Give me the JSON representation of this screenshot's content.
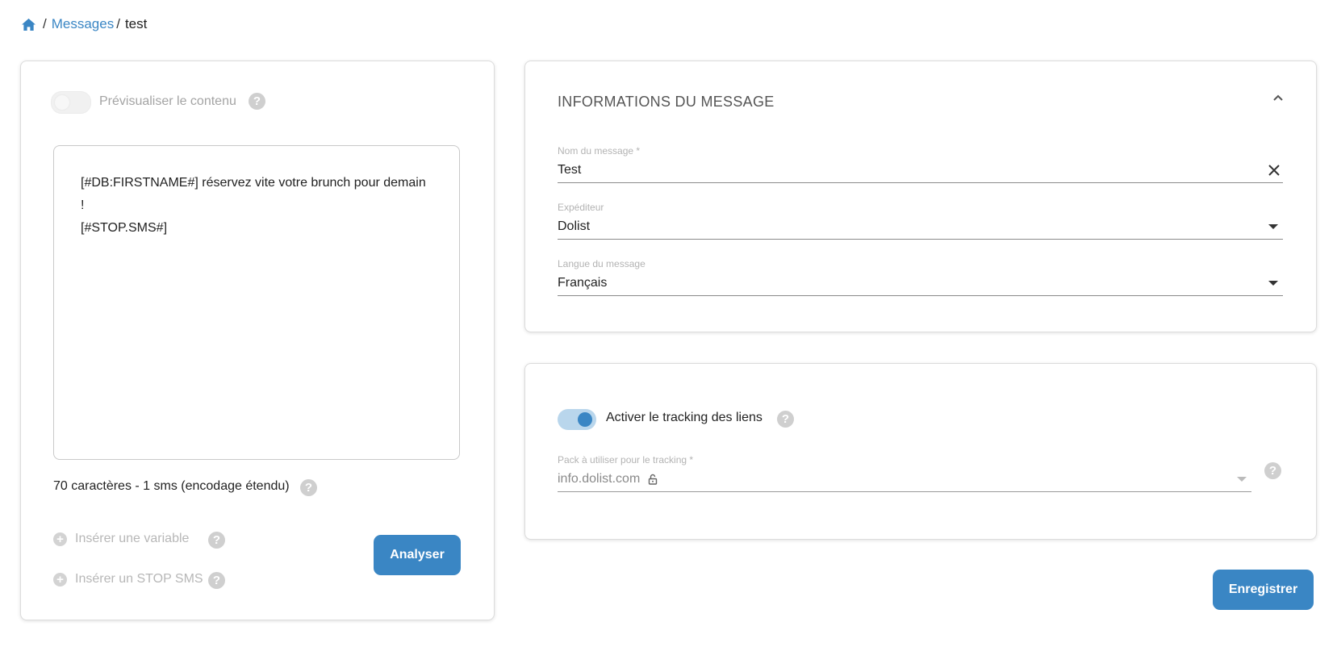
{
  "breadcrumb": {
    "home_icon": "home-icon",
    "separator": "/",
    "messages": "Messages",
    "current": "test"
  },
  "left": {
    "preview_label": "Prévisualiser le contenu",
    "sms_text_line1": "[#DB:FIRSTNAME#] réservez vite votre brunch pour demain !",
    "sms_text_line2": "[#STOP.SMS#]",
    "counter": "70 caractères - 1 sms (encodage étendu)",
    "insert_variable": "Insérer une variable",
    "insert_stop": "Insérer un STOP SMS",
    "analyse_button": "Analyser"
  },
  "info": {
    "title": "INFORMATIONS DU MESSAGE",
    "name_label": "Nom du message *",
    "name_value": "Test",
    "sender_label": "Expéditeur",
    "sender_value": "Dolist",
    "language_label": "Langue du message",
    "language_value": "Français"
  },
  "tracking": {
    "toggle_label": "Activer le tracking des liens",
    "toggle_on": true,
    "pack_label": "Pack à utiliser pour le tracking *",
    "pack_value": "info.dolist.com"
  },
  "save_button": "Enregistrer",
  "colors": {
    "accent": "#3a86c4",
    "toggle_track_on": "#b9d6ec",
    "help_icon": "#cfcfcf"
  }
}
